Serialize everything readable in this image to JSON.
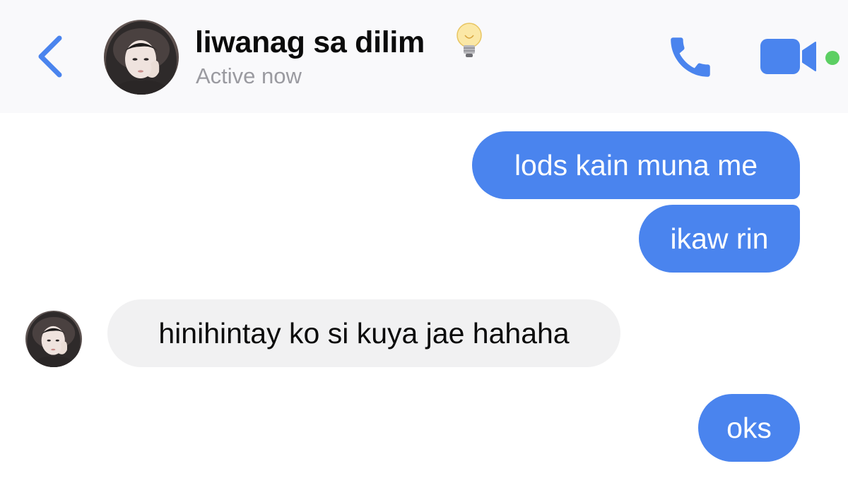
{
  "header": {
    "contact_name": "liwanag sa dilim",
    "name_emoji": "light-bulb",
    "status": "Active now",
    "back_icon": "chevron-left-icon",
    "call_icon": "phone-icon",
    "video_icon": "video-camera-icon",
    "online_indicator_color": "#5ccf63"
  },
  "colors": {
    "accent": "#4a84ee",
    "incoming_bubble": "#f1f1f2",
    "header_bg": "#f9f9fb",
    "muted_text": "#9a9aa0"
  },
  "messages": [
    {
      "direction": "outgoing",
      "text": "lods kain muna me"
    },
    {
      "direction": "outgoing",
      "text": "ikaw rin"
    },
    {
      "direction": "incoming",
      "text": "hinihintay ko si kuya jae hahaha"
    },
    {
      "direction": "outgoing",
      "text": "oks"
    }
  ]
}
